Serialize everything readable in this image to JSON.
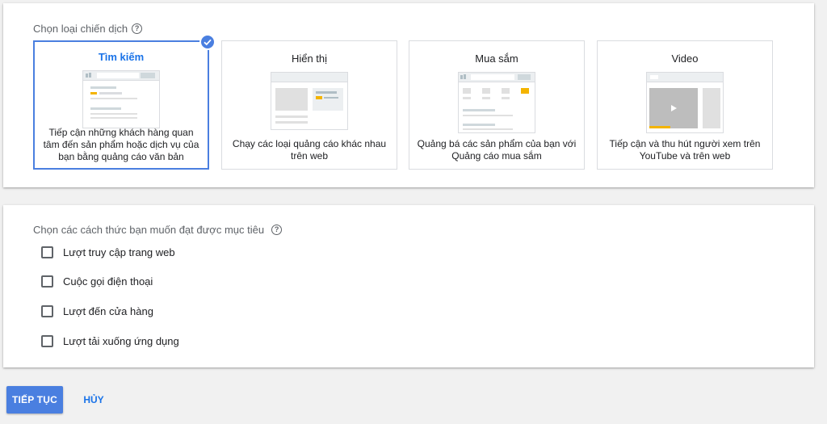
{
  "campaign_type": {
    "title": "Chọn loại chiến dịch",
    "cards": [
      {
        "title": "Tìm kiếm",
        "desc": "Tiếp cận những khách hàng quan tâm đến sản phẩm hoặc dịch vụ của bạn bằng quảng cáo văn bản",
        "selected": true
      },
      {
        "title": "Hiển thị",
        "desc": "Chạy các loại quảng cáo khác nhau trên web",
        "selected": false
      },
      {
        "title": "Mua sắm",
        "desc": "Quảng bá các sản phẩm của bạn với Quảng cáo mua sắm",
        "selected": false
      },
      {
        "title": "Video",
        "desc": "Tiếp cận và thu hút người xem trên YouTube và trên web",
        "selected": false
      }
    ]
  },
  "goals": {
    "title": "Chọn các cách thức bạn muốn đạt được mục tiêu",
    "options": [
      {
        "label": "Lượt truy cập trang web",
        "checked": false
      },
      {
        "label": "Cuộc gọi điện thoại",
        "checked": false
      },
      {
        "label": "Lượt đến cửa hàng",
        "checked": false
      },
      {
        "label": "Lượt tải xuống ứng dụng",
        "checked": false
      }
    ]
  },
  "actions": {
    "continue_label": "TIẾP TỤC",
    "cancel_label": "HỦY"
  },
  "colors": {
    "accent": "#4a7fe0",
    "highlight": "#f4b400"
  }
}
